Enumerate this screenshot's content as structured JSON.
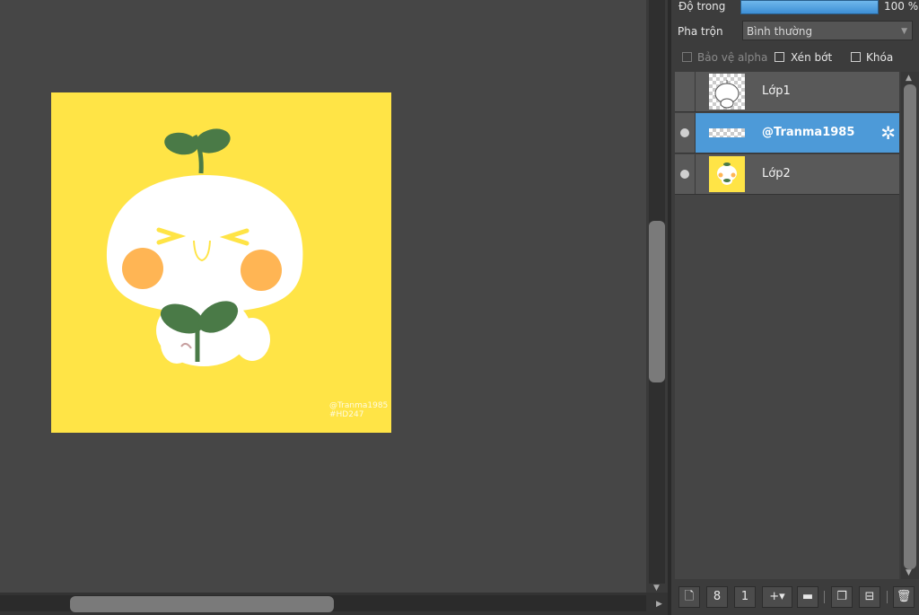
{
  "properties": {
    "opacity_label": "Độ trong",
    "opacity_value": "100 %",
    "opacity_fraction": 1.0,
    "blend_label": "Pha trộn",
    "blend_value": "Bình thường",
    "protect_alpha_label": "Bảo vệ alpha",
    "clipping_label": "Xén bớt",
    "lock_label": "Khóa"
  },
  "artwork": {
    "watermark_line1": "@Tranma1985",
    "watermark_line2": "#HD247",
    "background_color": "#ffe446"
  },
  "layers": [
    {
      "name": "Lớp1",
      "visible": false,
      "selected": false
    },
    {
      "name": "@Tranma1985",
      "visible": true,
      "selected": true
    },
    {
      "name": "Lớp2",
      "visible": true,
      "selected": false
    }
  ],
  "toolbar": {
    "icons": [
      "new-layer-icon",
      "new-raster-layer-icon",
      "new-1bit-layer-icon",
      "add-layer-dropdown-icon",
      "folder-icon",
      "duplicate-icon",
      "merge-down-icon",
      "trash-icon"
    ]
  },
  "colors": {
    "accent": "#4d9ad8",
    "panel_bg": "#3c3c3c",
    "canvas_bg": "#464646"
  }
}
